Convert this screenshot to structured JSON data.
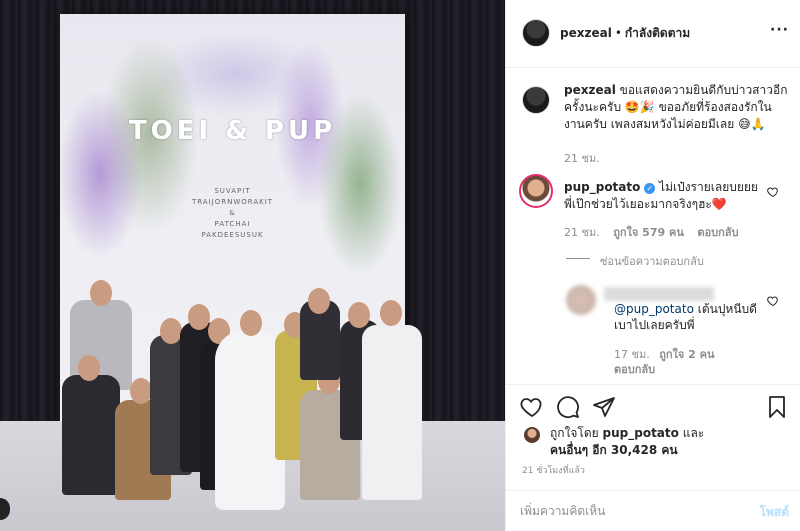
{
  "post": {
    "image_title": "TOEI & PUP",
    "image_names_line1": "SUVAPIT",
    "image_names_line2": "TRAIJORNWORAKIT",
    "image_names_line3": "&",
    "image_names_line4": "PATCHAI",
    "image_names_line5": "PAKDEESUSUK"
  },
  "header": {
    "username": "pexzeal",
    "separator": "•",
    "follow_status": "กำลังติดตาม",
    "more_icon": "more-options-icon",
    "more_text": "···"
  },
  "caption": {
    "username": "pexzeal",
    "text": "ขอแสดงความยินดีกับบ่าวสาวอีกครั้งนะครับ 🤩🎉 ขออภัยที่ร้องสองรักในงานครับ เพลงสมหวังไม่ค่อยมีเลย 😅🙏",
    "time": "21 ชม."
  },
  "comment1": {
    "username": "pup_potato",
    "verified_mark": "✓",
    "text": "ไม่เป๋งรายเลยบยยยพี่เป๊กช่วยไว้เยอะมากจริงๆฮะ❤️",
    "time": "21 ชม.",
    "likes": "ถูกใจ 579 คน",
    "reply": "ตอบกลับ",
    "hide_replies": "ซ่อนข้อความตอบกลับ"
  },
  "comment2": {
    "mention": "@pup_potato",
    "text": " เต้นปุหนีบดีเบาไปเลยครับพี่",
    "time": "17 ชม.",
    "likes": "ถูกใจ 2 คน",
    "reply": "ตอบกลับ"
  },
  "likes": {
    "prefix": "ถูกใจโดย ",
    "first_user": "pup_potato",
    "middle": " และ",
    "others": "คนอื่นๆ อีก 30,428 คน"
  },
  "timestamp": "21 ชั่วโมงที่แล้ว",
  "add_comment": {
    "placeholder": "เพิ่มความคิดเห็น",
    "post_label": "โพสต์"
  },
  "colors": {
    "accent_blue": "#3897f0",
    "post_disabled": "#b2dffc",
    "muted": "#8e8e8e",
    "story_ring": "#e1306c"
  }
}
